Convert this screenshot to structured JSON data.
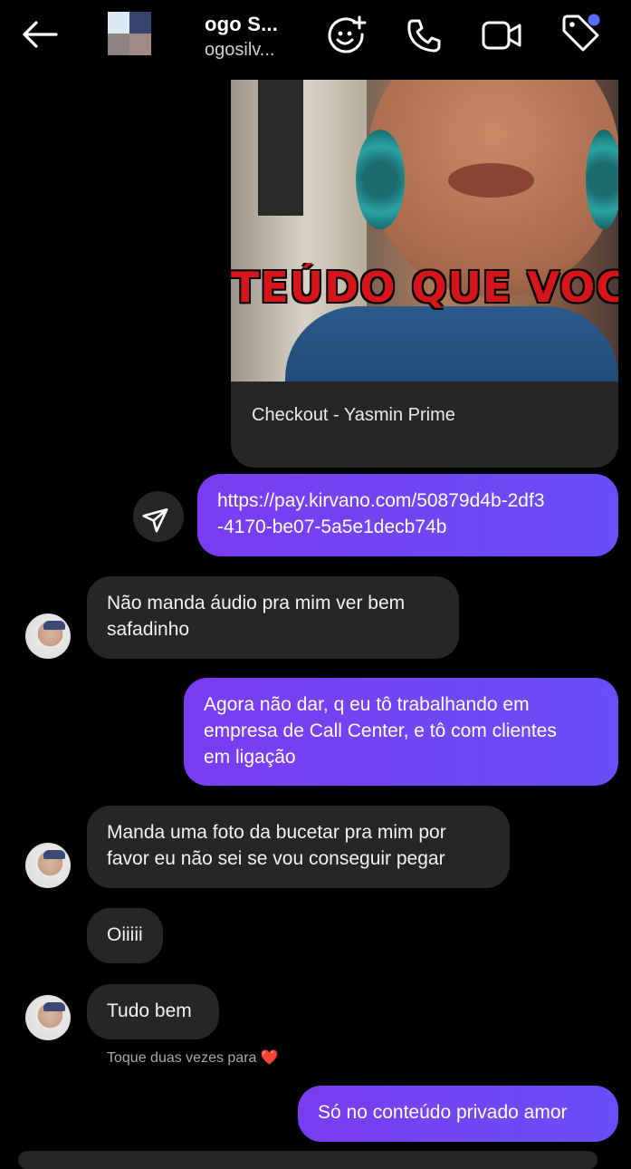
{
  "header": {
    "title": "ogo S...",
    "subtitle": "ogosilv...",
    "icons": [
      "back-arrow-icon",
      "add-emoji-icon",
      "phone-icon",
      "video-icon",
      "tag-icon"
    ],
    "notification_dot_color": "#5b6cff"
  },
  "card": {
    "image_banner": "TEÚDO  QUE VOCÊ",
    "title": "Checkout - Yasmin Prime"
  },
  "messages": [
    {
      "side": "out",
      "text": "https://pay.kirvano.com/50879d4b-2df3-4170-be07-5a5e1decb74b",
      "line1": "https://pay.kirvano.com/50879d4b-2df3",
      "line2": "-4170-be07-5a5e1decb74b"
    },
    {
      "side": "in",
      "line1": "Não manda áudio pra mim ver bem",
      "line2": "safadinho"
    },
    {
      "side": "out",
      "line1": "Agora não dar, q eu tô trabalhando em",
      "line2": "empresa de Call Center, e tô com clientes",
      "line3": "em ligação"
    },
    {
      "side": "in",
      "line1": "Manda uma foto da bucetar pra mim por",
      "line2": "favor eu não sei se vou conseguir pegar"
    },
    {
      "side": "in",
      "text": "Oiiiii"
    },
    {
      "side": "in",
      "text": "Tudo bem"
    },
    {
      "side": "out",
      "text": "Só no conteúdo privado amor"
    }
  ],
  "double_tap_hint": "Toque duas vezes para",
  "heart": "❤️"
}
